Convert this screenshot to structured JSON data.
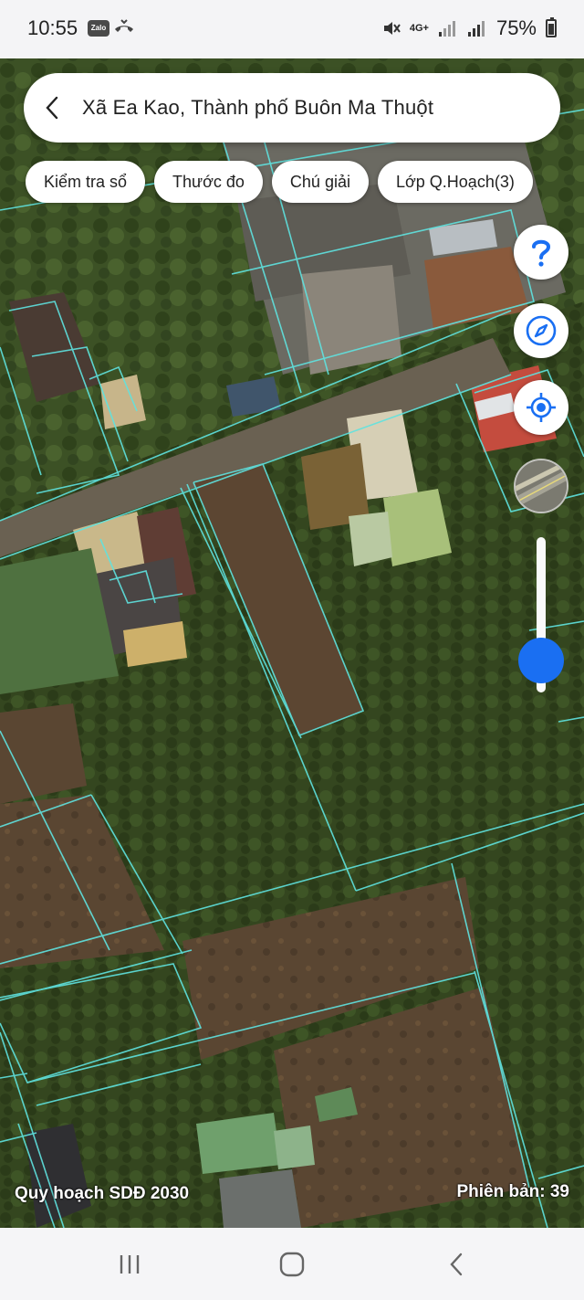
{
  "status_bar": {
    "time": "10:55",
    "zalo_label": "Zalo",
    "network": "4G+",
    "battery": "75%"
  },
  "search": {
    "location": "Xã Ea Kao, Thành phố Buôn Ma Thuột"
  },
  "chips": [
    {
      "label": "Kiểm tra sổ"
    },
    {
      "label": "Thước đo"
    },
    {
      "label": "Chú giải"
    },
    {
      "label": "Lớp Q.Hoạch(3)"
    }
  ],
  "map_controls": {
    "help_icon": "question-icon",
    "compass_icon": "compass-icon",
    "locate_icon": "locate-icon",
    "zoom_level": 0.15
  },
  "map_overlay": {
    "plan_label": "Quy hoạch SDĐ 2030",
    "version_label": "Phiên bản: 39"
  },
  "colors": {
    "accent": "#1a6ff2",
    "parcel_lines": "#5fe3e0"
  }
}
